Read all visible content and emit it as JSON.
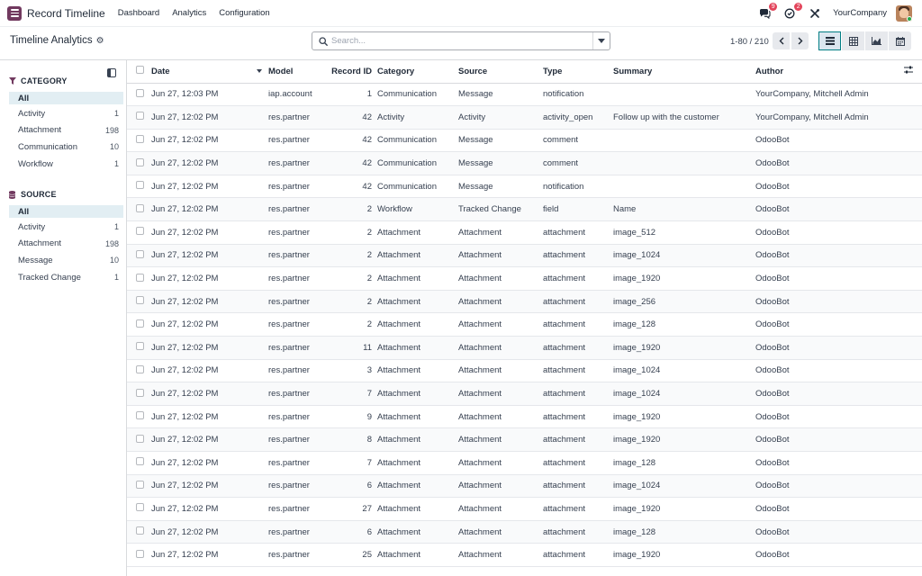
{
  "app": {
    "title": "Record Timeline",
    "menu": [
      "Dashboard",
      "Analytics",
      "Configuration"
    ],
    "messages_badge": "9",
    "activities_badge": "2",
    "company": "YourCompany"
  },
  "control": {
    "title": "Timeline Analytics",
    "search_placeholder": "Search...",
    "pager": "1-80 / 210"
  },
  "sidebar": {
    "category": {
      "heading": "CATEGORY",
      "items": [
        {
          "label": "All",
          "count": ""
        },
        {
          "label": "Activity",
          "count": "1"
        },
        {
          "label": "Attachment",
          "count": "198"
        },
        {
          "label": "Communication",
          "count": "10"
        },
        {
          "label": "Workflow",
          "count": "1"
        }
      ]
    },
    "source": {
      "heading": "SOURCE",
      "items": [
        {
          "label": "All",
          "count": ""
        },
        {
          "label": "Activity",
          "count": "1"
        },
        {
          "label": "Attachment",
          "count": "198"
        },
        {
          "label": "Message",
          "count": "10"
        },
        {
          "label": "Tracked Change",
          "count": "1"
        }
      ]
    }
  },
  "table": {
    "columns": [
      "Date",
      "Model",
      "Record ID",
      "Category",
      "Source",
      "Type",
      "Summary",
      "Author"
    ],
    "rows": [
      [
        "Jun 27, 12:03 PM",
        "iap.account",
        "1",
        "Communication",
        "Message",
        "notification",
        "",
        "YourCompany, Mitchell Admin"
      ],
      [
        "Jun 27, 12:02 PM",
        "res.partner",
        "42",
        "Activity",
        "Activity",
        "activity_open",
        "Follow up with the customer",
        "YourCompany, Mitchell Admin"
      ],
      [
        "Jun 27, 12:02 PM",
        "res.partner",
        "42",
        "Communication",
        "Message",
        "comment",
        "",
        "OdooBot"
      ],
      [
        "Jun 27, 12:02 PM",
        "res.partner",
        "42",
        "Communication",
        "Message",
        "comment",
        "",
        "OdooBot"
      ],
      [
        "Jun 27, 12:02 PM",
        "res.partner",
        "42",
        "Communication",
        "Message",
        "notification",
        "",
        "OdooBot"
      ],
      [
        "Jun 27, 12:02 PM",
        "res.partner",
        "2",
        "Workflow",
        "Tracked Change",
        "field",
        "Name",
        "OdooBot"
      ],
      [
        "Jun 27, 12:02 PM",
        "res.partner",
        "2",
        "Attachment",
        "Attachment",
        "attachment",
        "image_512",
        "OdooBot"
      ],
      [
        "Jun 27, 12:02 PM",
        "res.partner",
        "2",
        "Attachment",
        "Attachment",
        "attachment",
        "image_1024",
        "OdooBot"
      ],
      [
        "Jun 27, 12:02 PM",
        "res.partner",
        "2",
        "Attachment",
        "Attachment",
        "attachment",
        "image_1920",
        "OdooBot"
      ],
      [
        "Jun 27, 12:02 PM",
        "res.partner",
        "2",
        "Attachment",
        "Attachment",
        "attachment",
        "image_256",
        "OdooBot"
      ],
      [
        "Jun 27, 12:02 PM",
        "res.partner",
        "2",
        "Attachment",
        "Attachment",
        "attachment",
        "image_128",
        "OdooBot"
      ],
      [
        "Jun 27, 12:02 PM",
        "res.partner",
        "11",
        "Attachment",
        "Attachment",
        "attachment",
        "image_1920",
        "OdooBot"
      ],
      [
        "Jun 27, 12:02 PM",
        "res.partner",
        "3",
        "Attachment",
        "Attachment",
        "attachment",
        "image_1024",
        "OdooBot"
      ],
      [
        "Jun 27, 12:02 PM",
        "res.partner",
        "7",
        "Attachment",
        "Attachment",
        "attachment",
        "image_1024",
        "OdooBot"
      ],
      [
        "Jun 27, 12:02 PM",
        "res.partner",
        "9",
        "Attachment",
        "Attachment",
        "attachment",
        "image_1920",
        "OdooBot"
      ],
      [
        "Jun 27, 12:02 PM",
        "res.partner",
        "8",
        "Attachment",
        "Attachment",
        "attachment",
        "image_1920",
        "OdooBot"
      ],
      [
        "Jun 27, 12:02 PM",
        "res.partner",
        "7",
        "Attachment",
        "Attachment",
        "attachment",
        "image_128",
        "OdooBot"
      ],
      [
        "Jun 27, 12:02 PM",
        "res.partner",
        "6",
        "Attachment",
        "Attachment",
        "attachment",
        "image_1024",
        "OdooBot"
      ],
      [
        "Jun 27, 12:02 PM",
        "res.partner",
        "27",
        "Attachment",
        "Attachment",
        "attachment",
        "image_1920",
        "OdooBot"
      ],
      [
        "Jun 27, 12:02 PM",
        "res.partner",
        "6",
        "Attachment",
        "Attachment",
        "attachment",
        "image_128",
        "OdooBot"
      ],
      [
        "Jun 27, 12:02 PM",
        "res.partner",
        "25",
        "Attachment",
        "Attachment",
        "attachment",
        "image_1920",
        "OdooBot"
      ]
    ]
  },
  "colors": {
    "brand": "#71395f",
    "accent": "#017e84",
    "badge": "#e3445b"
  }
}
